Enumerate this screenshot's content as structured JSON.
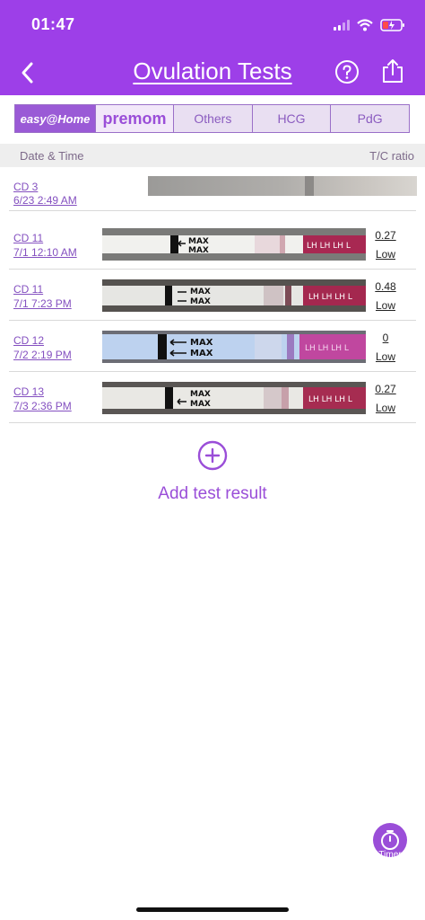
{
  "status_bar": {
    "time": "01:47"
  },
  "header": {
    "title": "Ovulation Tests"
  },
  "brand_tabs": [
    {
      "label": "easy@Home"
    },
    {
      "label": "premom"
    },
    {
      "label": "Others"
    },
    {
      "label": "HCG"
    },
    {
      "label": "PdG"
    }
  ],
  "columns": {
    "left": "Date & Time",
    "right": "T/C ratio"
  },
  "rows": [
    {
      "cd": "CD 3",
      "datetime": "6/23 2:49 AM",
      "ratio": "",
      "level": ""
    },
    {
      "cd": "CD 11",
      "datetime": "7/1 12:10 AM",
      "ratio": "0.27",
      "level": "Low"
    },
    {
      "cd": "CD 11",
      "datetime": "7/1 7:23 PM",
      "ratio": "0.48",
      "level": "Low"
    },
    {
      "cd": "CD 12",
      "datetime": "7/2 2:19 PM",
      "ratio": "0",
      "level": "Low"
    },
    {
      "cd": "CD 13",
      "datetime": "7/3 2:36 PM",
      "ratio": "0.27",
      "level": "Low"
    }
  ],
  "strip_text": {
    "max": "MAX",
    "lh": "LH LH LH L"
  },
  "add_button": {
    "label": "Add test result"
  },
  "timer": {
    "label": "Timer"
  },
  "colors": {
    "brand": "#9d3fe8",
    "accent": "#9a4ed8"
  }
}
